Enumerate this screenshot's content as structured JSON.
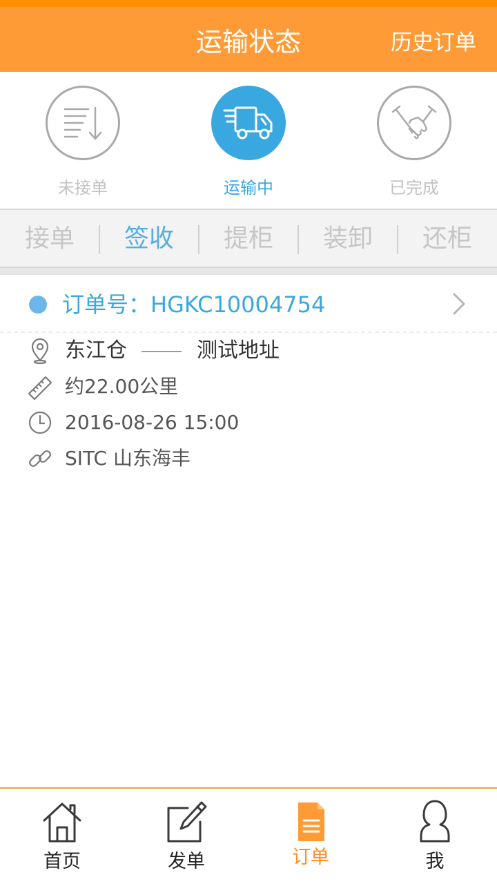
{
  "header": {
    "title": "运输状态",
    "history_label": "历史订单"
  },
  "status_tabs": [
    {
      "label": "未接单",
      "icon": "list-sort-icon",
      "active": false
    },
    {
      "label": "运输中",
      "icon": "truck-icon",
      "active": true
    },
    {
      "label": "已完成",
      "icon": "handshake-icon",
      "active": false
    }
  ],
  "steps": [
    {
      "label": "接单",
      "active": false
    },
    {
      "label": "签收",
      "active": true
    },
    {
      "label": "提柜",
      "active": false
    },
    {
      "label": "装卸",
      "active": false
    },
    {
      "label": "还柜",
      "active": false
    }
  ],
  "order": {
    "number_label": "订单号：HGKC10004754",
    "origin": "东江仓",
    "destination": "测试地址",
    "distance": "约22.00公里",
    "time": "2016-08-26 15:00",
    "carrier": "SITC 山东海丰"
  },
  "tabbar": [
    {
      "label": "首页",
      "icon": "home-icon",
      "active": false
    },
    {
      "label": "发单",
      "icon": "edit-icon",
      "active": false
    },
    {
      "label": "订单",
      "icon": "order-document-icon",
      "active": true
    },
    {
      "label": "我",
      "icon": "user-icon",
      "active": false
    }
  ],
  "colors": {
    "brand_orange": "#ff9b36",
    "accent_blue": "#3aa8e0",
    "inactive_gray": "#c6c6c6"
  }
}
